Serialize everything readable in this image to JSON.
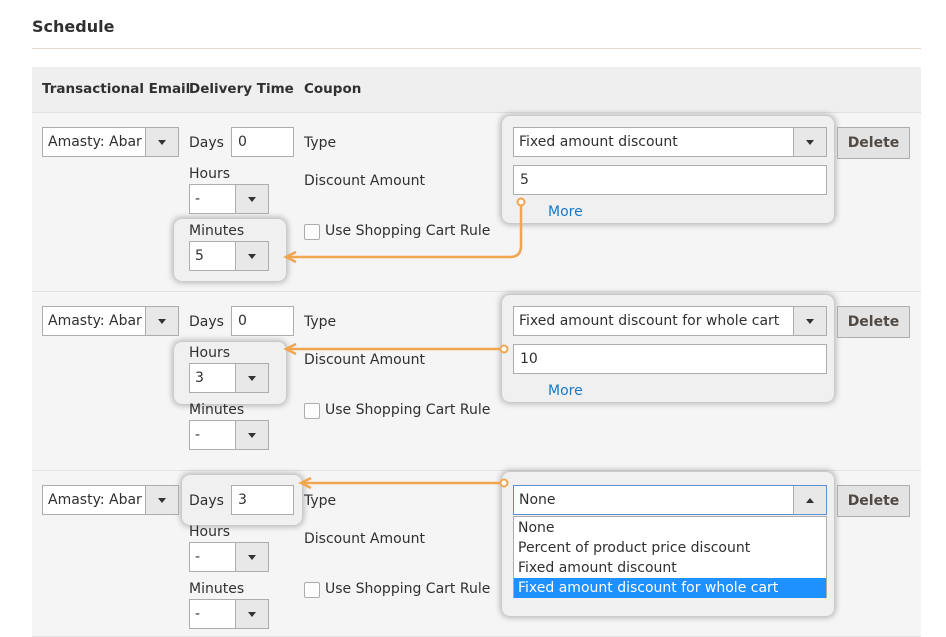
{
  "page": {
    "title": "Schedule"
  },
  "columns": [
    "Transactional Email",
    "Delivery Time",
    "Coupon"
  ],
  "labels": {
    "days": "Days",
    "hours": "Hours",
    "minutes": "Minutes",
    "type": "Type",
    "discount_amount": "Discount Amount",
    "use_rule": "Use Shopping Cart Rule",
    "more": "More",
    "delete": "Delete"
  },
  "rows": [
    {
      "email": "Amasty: Abar",
      "days": "0",
      "hours": "-",
      "minutes": "5",
      "coupon_type": "Fixed amount discount",
      "discount_amount": "5"
    },
    {
      "email": "Amasty: Abar",
      "days": "0",
      "hours": "3",
      "minutes": "-",
      "coupon_type": "Fixed amount discount for whole cart",
      "discount_amount": "10"
    },
    {
      "email": "Amasty: Abar",
      "days": "3",
      "hours": "-",
      "minutes": "-",
      "coupon_type": "None",
      "discount_amount": ""
    }
  ],
  "dropdown_options": [
    "None",
    "Percent of product price discount",
    "Fixed amount discount",
    "Fixed amount discount for whole cart"
  ],
  "dropdown_selected_option": "Fixed amount discount for whole cart",
  "colors": {
    "accent_arrow": "#f0a54e",
    "link": "#1979c3",
    "selected": "#1e90ff"
  }
}
